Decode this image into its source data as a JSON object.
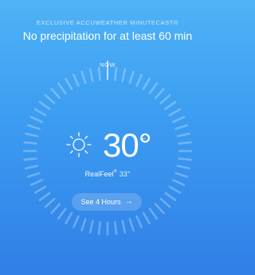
{
  "header": {
    "eyebrow": "EXCLUSIVE ACCUWEATHER MINUTECAST",
    "trademark": "®",
    "headline": "No precipitation for at least 60 min"
  },
  "dial": {
    "now_label": "NOW",
    "tick_count": 60,
    "ring_color": "#ffffff"
  },
  "current": {
    "icon": "sun-icon",
    "temperature": "30°",
    "unit": "C",
    "realfeel_label": "RealFeel",
    "realfeel_mark": "®",
    "realfeel_value": "33°"
  },
  "cta": {
    "label": "See 4 Hours",
    "arrow": "→"
  },
  "colors": {
    "background_top": "#4fb3f6",
    "background_bottom": "#2f7fe6",
    "text": "#ffffff"
  }
}
